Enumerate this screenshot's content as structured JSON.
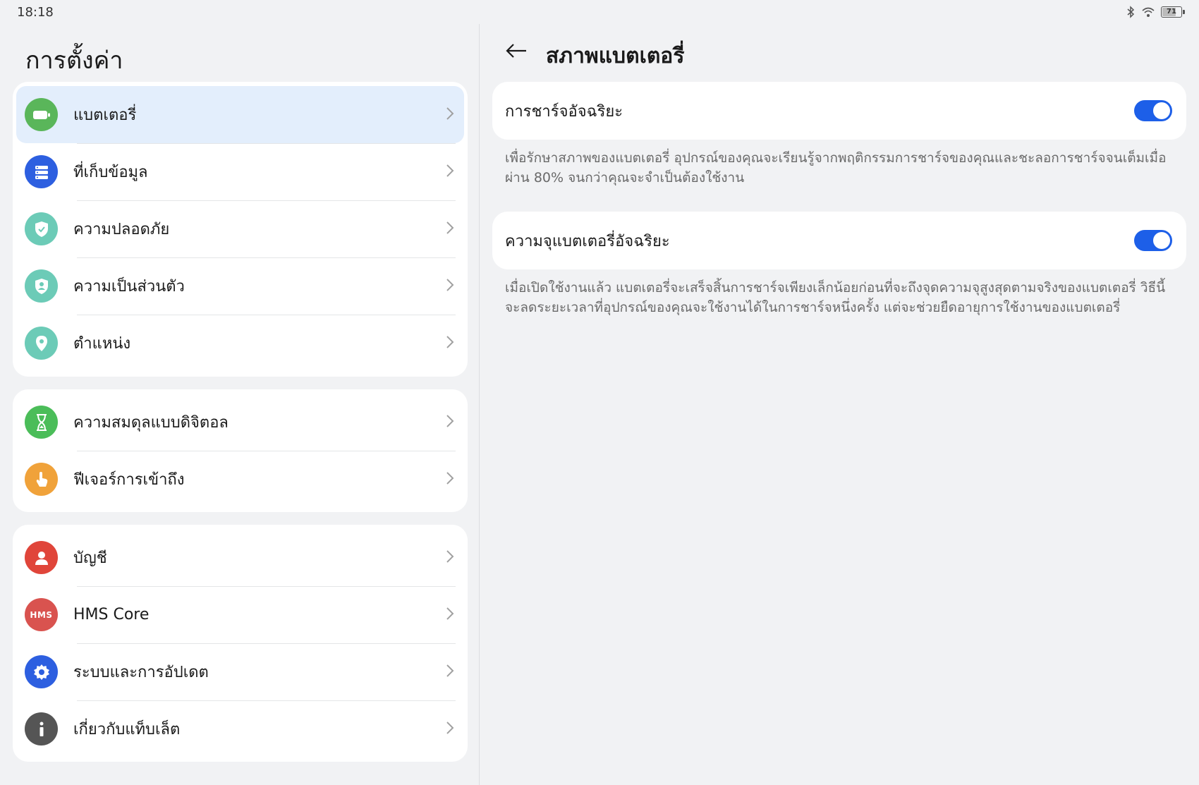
{
  "status_bar": {
    "time": "18:18",
    "battery_level": "71",
    "icons": [
      "bluetooth-icon",
      "wifi-icon",
      "battery-icon"
    ]
  },
  "left": {
    "title": "การตั้งค่า",
    "groups": [
      {
        "items": [
          {
            "label": "แบตเตอรี่",
            "icon": "battery-icon",
            "color": "#5ab65a",
            "selected": true
          },
          {
            "label": "ที่เก็บข้อมูล",
            "icon": "storage-icon",
            "color": "#2d5fe0"
          },
          {
            "label": "ความปลอดภัย",
            "icon": "shield-check-icon",
            "color": "#6ccbb7"
          },
          {
            "label": "ความเป็นส่วนตัว",
            "icon": "privacy-shield-icon",
            "color": "#6ccbb7"
          },
          {
            "label": "ตำแหน่ง",
            "icon": "location-pin-icon",
            "color": "#6ccbb7"
          }
        ]
      },
      {
        "items": [
          {
            "label": "ความสมดุลแบบดิจิตอล",
            "icon": "hourglass-icon",
            "color": "#4bbd59"
          },
          {
            "label": "ฟีเจอร์การเข้าถึง",
            "icon": "hand-pointer-icon",
            "color": "#f0a23a"
          }
        ]
      },
      {
        "items": [
          {
            "label": "บัญชี",
            "icon": "user-icon",
            "color": "#e0453a"
          },
          {
            "label": "HMS Core",
            "icon": "hms-icon",
            "color": "#d9534f",
            "icon_text": "HMS"
          },
          {
            "label": "ระบบและการอัปเดต",
            "icon": "gear-icon",
            "color": "#2d5fe0"
          },
          {
            "label": "เกี่ยวกับแท็บเล็ต",
            "icon": "info-icon",
            "color": "#555555"
          }
        ]
      }
    ]
  },
  "right": {
    "title": "สภาพแบตเตอรี่",
    "settings": [
      {
        "label": "การชาร์จอัจฉริยะ",
        "enabled": true,
        "description": "เพื่อรักษาสภาพของแบตเตอรี่ อุปกรณ์ของคุณจะเรียนรู้จากพฤติกรรมการชาร์จของคุณและชะลอการชาร์จจนเต็มเมื่อผ่าน 80% จนกว่าคุณจะจำเป็นต้องใช้งาน"
      },
      {
        "label": "ความจุแบตเตอรี่อัจฉริยะ",
        "enabled": true,
        "description": "เมื่อเปิดใช้งานแล้ว แบตเตอรี่จะเสร็จสิ้นการชาร์จเพียงเล็กน้อยก่อนที่จะถึงจุดความจุสูงสุดตามจริงของแบตเตอรี่ วิธีนี้จะลดระยะเวลาที่อุปกรณ์ของคุณจะใช้งานได้ในการชาร์จหนึ่งครั้ง แต่จะช่วยยืดอายุการใช้งานของแบตเตอรี่"
      }
    ],
    "accent_color": "#1d5fe8"
  }
}
